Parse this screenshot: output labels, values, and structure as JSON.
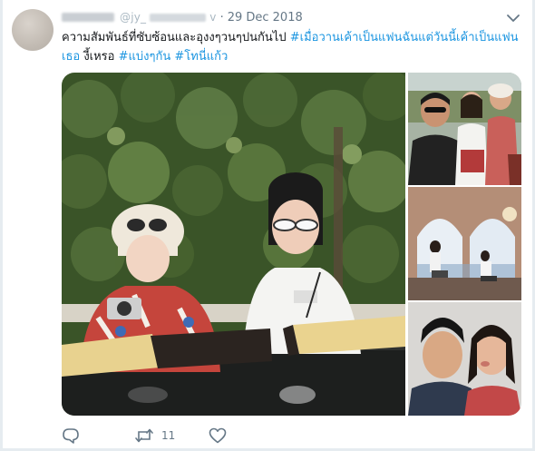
{
  "tweet": {
    "handle_prefix": "@jy_",
    "handle_suffix": "v",
    "separator": "·",
    "date": "29 Dec 2018",
    "text_plain": "ความสัมพันธ์ที่ซับซ้อนและอุงงๆวนๆปนกันไป ",
    "hashtags_line1": "#เมื่อวานเค้าเป็นแฟนฉันแต่วันนี้เค้าเป็นแฟน",
    "hashtags_line2_start": "เธอ",
    "text_plain_2": " งี้เหรอ ",
    "hashtag_2": "#แบ่งๆกัน",
    "hashtag_3": "#โทนี่แก้ว"
  },
  "actions": {
    "reply_count": "",
    "retweet_count": "11",
    "like_count": ""
  },
  "colors": {
    "link": "#1b95e0",
    "muted": "#657786",
    "text": "#14171a"
  },
  "icons": [
    "chevron-down-icon",
    "reply-icon",
    "retweet-icon",
    "like-icon"
  ]
}
